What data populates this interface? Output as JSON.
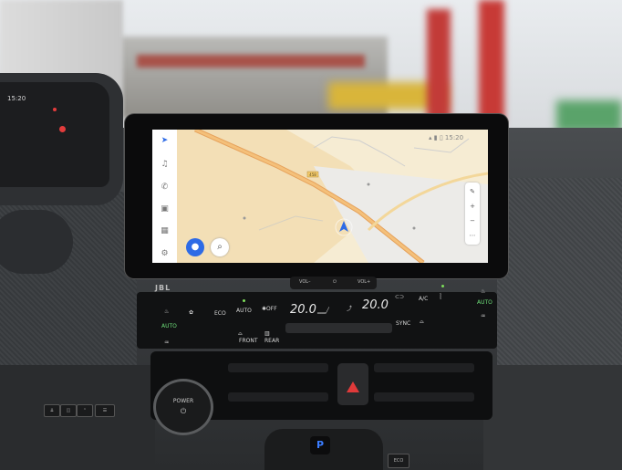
{
  "cluster": {
    "time": "15:20"
  },
  "screen": {
    "status_time": "15:20",
    "map_road_label": "458"
  },
  "console": {
    "brand": "JBL",
    "vol_down": "VOL–",
    "vol_up": "VOL+",
    "power_label": "POWER",
    "gear": "P",
    "eco_label": "ECO"
  },
  "climate": {
    "left_auto": "AUTO",
    "eco": "ECO",
    "auto": "AUTO",
    "off": "OFF",
    "temp_left": "20.0",
    "temp_right": "20.0",
    "sync": "SYNC",
    "ac": "A/C",
    "right_auto": "AUTO",
    "front": "FRONT",
    "rear": "REAR"
  },
  "colors": {
    "map_road_main": "#f0a34a",
    "map_land": "#f6e7c4",
    "nav_blue": "#2e6be6",
    "indicator_green": "#6ee07a",
    "hazard_red": "#e03a3a",
    "gear_blue": "#3b7dff"
  }
}
